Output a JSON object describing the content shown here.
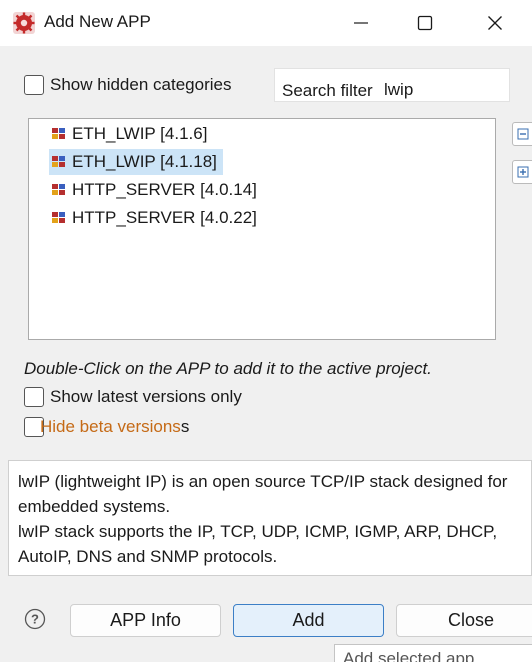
{
  "window": {
    "title": "Add New APP",
    "icon": "red-cog-app-icon",
    "controls": [
      "minimize-icon",
      "maximize-icon",
      "close-icon"
    ]
  },
  "filters": {
    "show_hidden_label": "Show hidden categories",
    "show_hidden_checked": false,
    "search_label": "Search filter",
    "search_value": "lwip"
  },
  "apps": [
    {
      "label": "ETH_LWIP [4.1.6]",
      "selected": false
    },
    {
      "label": "ETH_LWIP [4.1.18]",
      "selected": true
    },
    {
      "label": "HTTP_SERVER [4.0.14]",
      "selected": false
    },
    {
      "label": "HTTP_SERVER [4.0.22]",
      "selected": false
    }
  ],
  "side_buttons": [
    "collapse-all-icon",
    "expand-all-icon"
  ],
  "hint": "Double-Click on the APP to add it to the active project.",
  "options": {
    "latest_only_label": "Show latest versions only",
    "latest_only_checked": false,
    "hide_beta_label": "Hide beta versions",
    "hide_beta_suffix": "s",
    "hide_beta_checked": false
  },
  "description": {
    "line1": "lwIP (lightweight IP) is an open source TCP/IP stack designed for",
    "line2": "embedded systems.",
    "line3": "lwIP stack supports the IP, TCP, UDP, ICMP, IGMP, ARP, DHCP,",
    "line4": "AutoIP, DNS and SNMP protocols."
  },
  "buttons": {
    "help_icon": "help-icon",
    "app_info": "APP Info",
    "add": "Add",
    "close": "Close"
  },
  "tooltip": "Add selected app",
  "colors": {
    "selection": "#cce4f7",
    "beta_text": "#c56a16",
    "default_button_border": "#3c7fc6"
  }
}
